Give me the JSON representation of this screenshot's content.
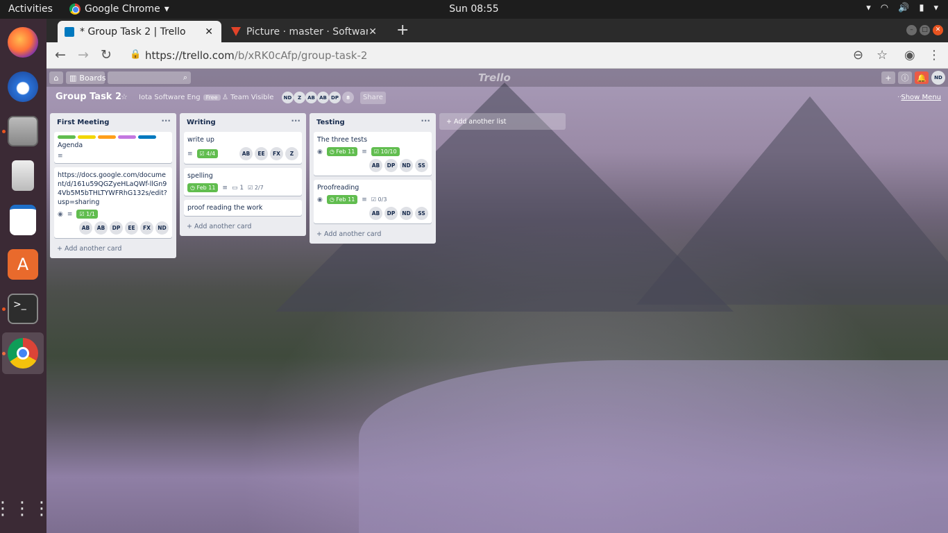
{
  "os_bar": {
    "activities": "Activities",
    "app_name": "Google Chrome",
    "clock": "Sun 08:55"
  },
  "dock": {
    "items": [
      "firefox-icon",
      "thunderbird-icon",
      "files-icon",
      "rhythmbox-icon",
      "writer-icon",
      "software-icon",
      "terminal-icon",
      "chrome-icon"
    ]
  },
  "browser": {
    "tabs": [
      {
        "title": "* Group Task 2 | Trello",
        "active": true
      },
      {
        "title": "Picture · master · Softwar",
        "active": false
      }
    ],
    "url_host": "https://trello.com",
    "url_path": "/b/xRK0cAfp/group-task-2"
  },
  "trello": {
    "header": {
      "boards_label": "Boards",
      "logo": "Trello",
      "user_initials": "ND"
    },
    "board": {
      "name": "Group Task 2",
      "team": "Iota Software Eng",
      "team_badge": "Free",
      "visibility": "Team Visible",
      "members": [
        "ND",
        "Z",
        "AB",
        "AB",
        "DP"
      ],
      "extra_count": "8",
      "share_label": "Share",
      "show_menu": "Show Menu"
    },
    "lists": [
      {
        "title": "First Meeting",
        "add_label": "Add another card",
        "cards": [
          {
            "text": "Agenda",
            "label_colors": [
              "#61bd4f",
              "#f2d600",
              "#ff9f1a",
              "#c377e0",
              "#0079bf"
            ]
          },
          {
            "text": "https://docs.google.com/document/d/161u59QGZyeHLaQWf-llGn94Vb5M5bTHLTYWFRhG132s/edit?usp=sharing",
            "checklist": "1/1",
            "members": [
              "AB",
              "AB",
              "DP",
              "EE",
              "FX",
              "ND"
            ]
          }
        ]
      },
      {
        "title": "Writing",
        "add_label": "Add another card",
        "cards": [
          {
            "text": "write up",
            "checklist": "4/4",
            "members": [
              "AB",
              "EE",
              "FX",
              "Z"
            ]
          },
          {
            "text": "spelling",
            "due": "Feb 11",
            "comments": "1",
            "checklist_plain": "2/7"
          },
          {
            "text": "proof reading the work"
          }
        ]
      },
      {
        "title": "Testing",
        "add_label": "Add another card",
        "cards": [
          {
            "text": "The three tests",
            "due": "Feb 11",
            "checklist": "10/10",
            "members": [
              "AB",
              "DP",
              "ND",
              "SS"
            ]
          },
          {
            "text": "Proofreading",
            "due": "Feb 11",
            "checklist_plain": "0/3",
            "members": [
              "AB",
              "DP",
              "ND",
              "SS"
            ]
          }
        ]
      }
    ],
    "add_list_label": "Add another list"
  }
}
